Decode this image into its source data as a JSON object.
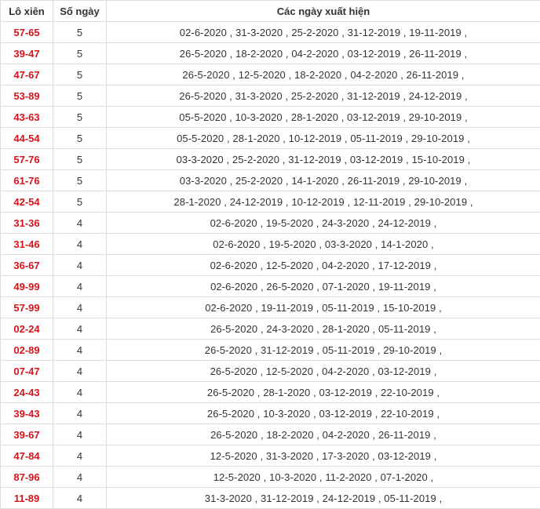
{
  "table": {
    "headers": [
      "Lô xiên",
      "Số ngày",
      "Các ngày xuất hiện"
    ],
    "accent_color": "#d4141a",
    "rows": [
      {
        "pair": "57-65",
        "count": "5",
        "dates": "02-6-2020 , 31-3-2020 , 25-2-2020 , 31-12-2019 , 19-11-2019 ,"
      },
      {
        "pair": "39-47",
        "count": "5",
        "dates": "26-5-2020 , 18-2-2020 , 04-2-2020 , 03-12-2019 , 26-11-2019 ,"
      },
      {
        "pair": "47-67",
        "count": "5",
        "dates": "26-5-2020 , 12-5-2020 , 18-2-2020 , 04-2-2020 , 26-11-2019 ,"
      },
      {
        "pair": "53-89",
        "count": "5",
        "dates": "26-5-2020 , 31-3-2020 , 25-2-2020 , 31-12-2019 , 24-12-2019 ,"
      },
      {
        "pair": "43-63",
        "count": "5",
        "dates": "05-5-2020 , 10-3-2020 , 28-1-2020 , 03-12-2019 , 29-10-2019 ,"
      },
      {
        "pair": "44-54",
        "count": "5",
        "dates": "05-5-2020 , 28-1-2020 , 10-12-2019 , 05-11-2019 , 29-10-2019 ,"
      },
      {
        "pair": "57-76",
        "count": "5",
        "dates": "03-3-2020 , 25-2-2020 , 31-12-2019 , 03-12-2019 , 15-10-2019 ,"
      },
      {
        "pair": "61-76",
        "count": "5",
        "dates": "03-3-2020 , 25-2-2020 , 14-1-2020 , 26-11-2019 , 29-10-2019 ,"
      },
      {
        "pair": "42-54",
        "count": "5",
        "dates": "28-1-2020 , 24-12-2019 , 10-12-2019 , 12-11-2019 , 29-10-2019 ,"
      },
      {
        "pair": "31-36",
        "count": "4",
        "dates": "02-6-2020 , 19-5-2020 , 24-3-2020 , 24-12-2019 ,"
      },
      {
        "pair": "31-46",
        "count": "4",
        "dates": "02-6-2020 , 19-5-2020 , 03-3-2020 , 14-1-2020 ,"
      },
      {
        "pair": "36-67",
        "count": "4",
        "dates": "02-6-2020 , 12-5-2020 , 04-2-2020 , 17-12-2019 ,"
      },
      {
        "pair": "49-99",
        "count": "4",
        "dates": "02-6-2020 , 26-5-2020 , 07-1-2020 , 19-11-2019 ,"
      },
      {
        "pair": "57-99",
        "count": "4",
        "dates": "02-6-2020 , 19-11-2019 , 05-11-2019 , 15-10-2019 ,"
      },
      {
        "pair": "02-24",
        "count": "4",
        "dates": "26-5-2020 , 24-3-2020 , 28-1-2020 , 05-11-2019 ,"
      },
      {
        "pair": "02-89",
        "count": "4",
        "dates": "26-5-2020 , 31-12-2019 , 05-11-2019 , 29-10-2019 ,"
      },
      {
        "pair": "07-47",
        "count": "4",
        "dates": "26-5-2020 , 12-5-2020 , 04-2-2020 , 03-12-2019 ,"
      },
      {
        "pair": "24-43",
        "count": "4",
        "dates": "26-5-2020 , 28-1-2020 , 03-12-2019 , 22-10-2019 ,"
      },
      {
        "pair": "39-43",
        "count": "4",
        "dates": "26-5-2020 , 10-3-2020 , 03-12-2019 , 22-10-2019 ,"
      },
      {
        "pair": "39-67",
        "count": "4",
        "dates": "26-5-2020 , 18-2-2020 , 04-2-2020 , 26-11-2019 ,"
      },
      {
        "pair": "47-84",
        "count": "4",
        "dates": "12-5-2020 , 31-3-2020 , 17-3-2020 , 03-12-2019 ,"
      },
      {
        "pair": "87-96",
        "count": "4",
        "dates": "12-5-2020 , 10-3-2020 , 11-2-2020 , 07-1-2020 ,"
      },
      {
        "pair": "11-89",
        "count": "4",
        "dates": "31-3-2020 , 31-12-2019 , 24-12-2019 , 05-11-2019 ,"
      }
    ]
  }
}
